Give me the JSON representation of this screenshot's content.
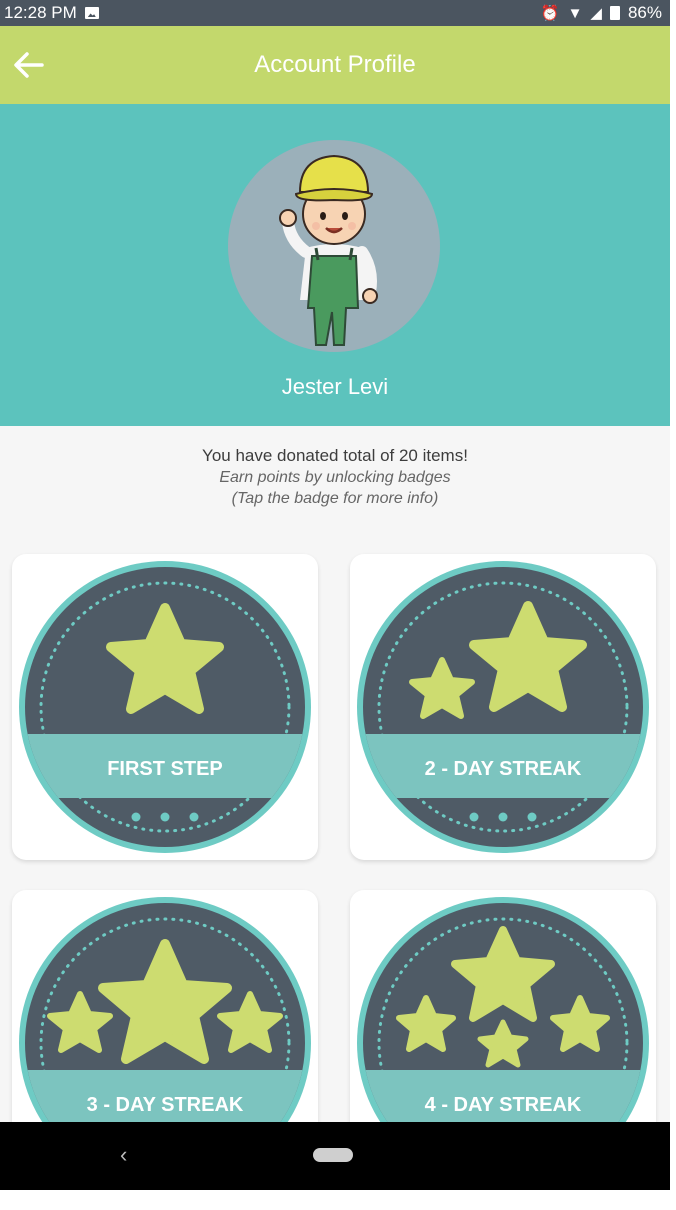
{
  "status_bar": {
    "time": "12:28 PM",
    "battery": "86%"
  },
  "app_bar": {
    "title": "Account Profile"
  },
  "profile": {
    "name": "Jester Levi"
  },
  "info": {
    "line1": "You have donated total of 20 items!",
    "line2": "Earn points by unlocking badges",
    "line3": "(Tap the badge for more info)"
  },
  "badges": [
    {
      "label": "FIRST STEP",
      "stars": 1
    },
    {
      "label": "2 - DAY STREAK",
      "stars": 2
    },
    {
      "label": "3 - DAY STREAK",
      "stars": 3
    },
    {
      "label": "4 - DAY STREAK",
      "stars": 4
    }
  ],
  "colors": {
    "app_bar": "#c3d86c",
    "profile_bg": "#5cc3bd",
    "badge_dark": "#4f5b66",
    "badge_ring": "#6ecbc4",
    "badge_band": "#7cc4bf",
    "star": "#cddc70"
  }
}
